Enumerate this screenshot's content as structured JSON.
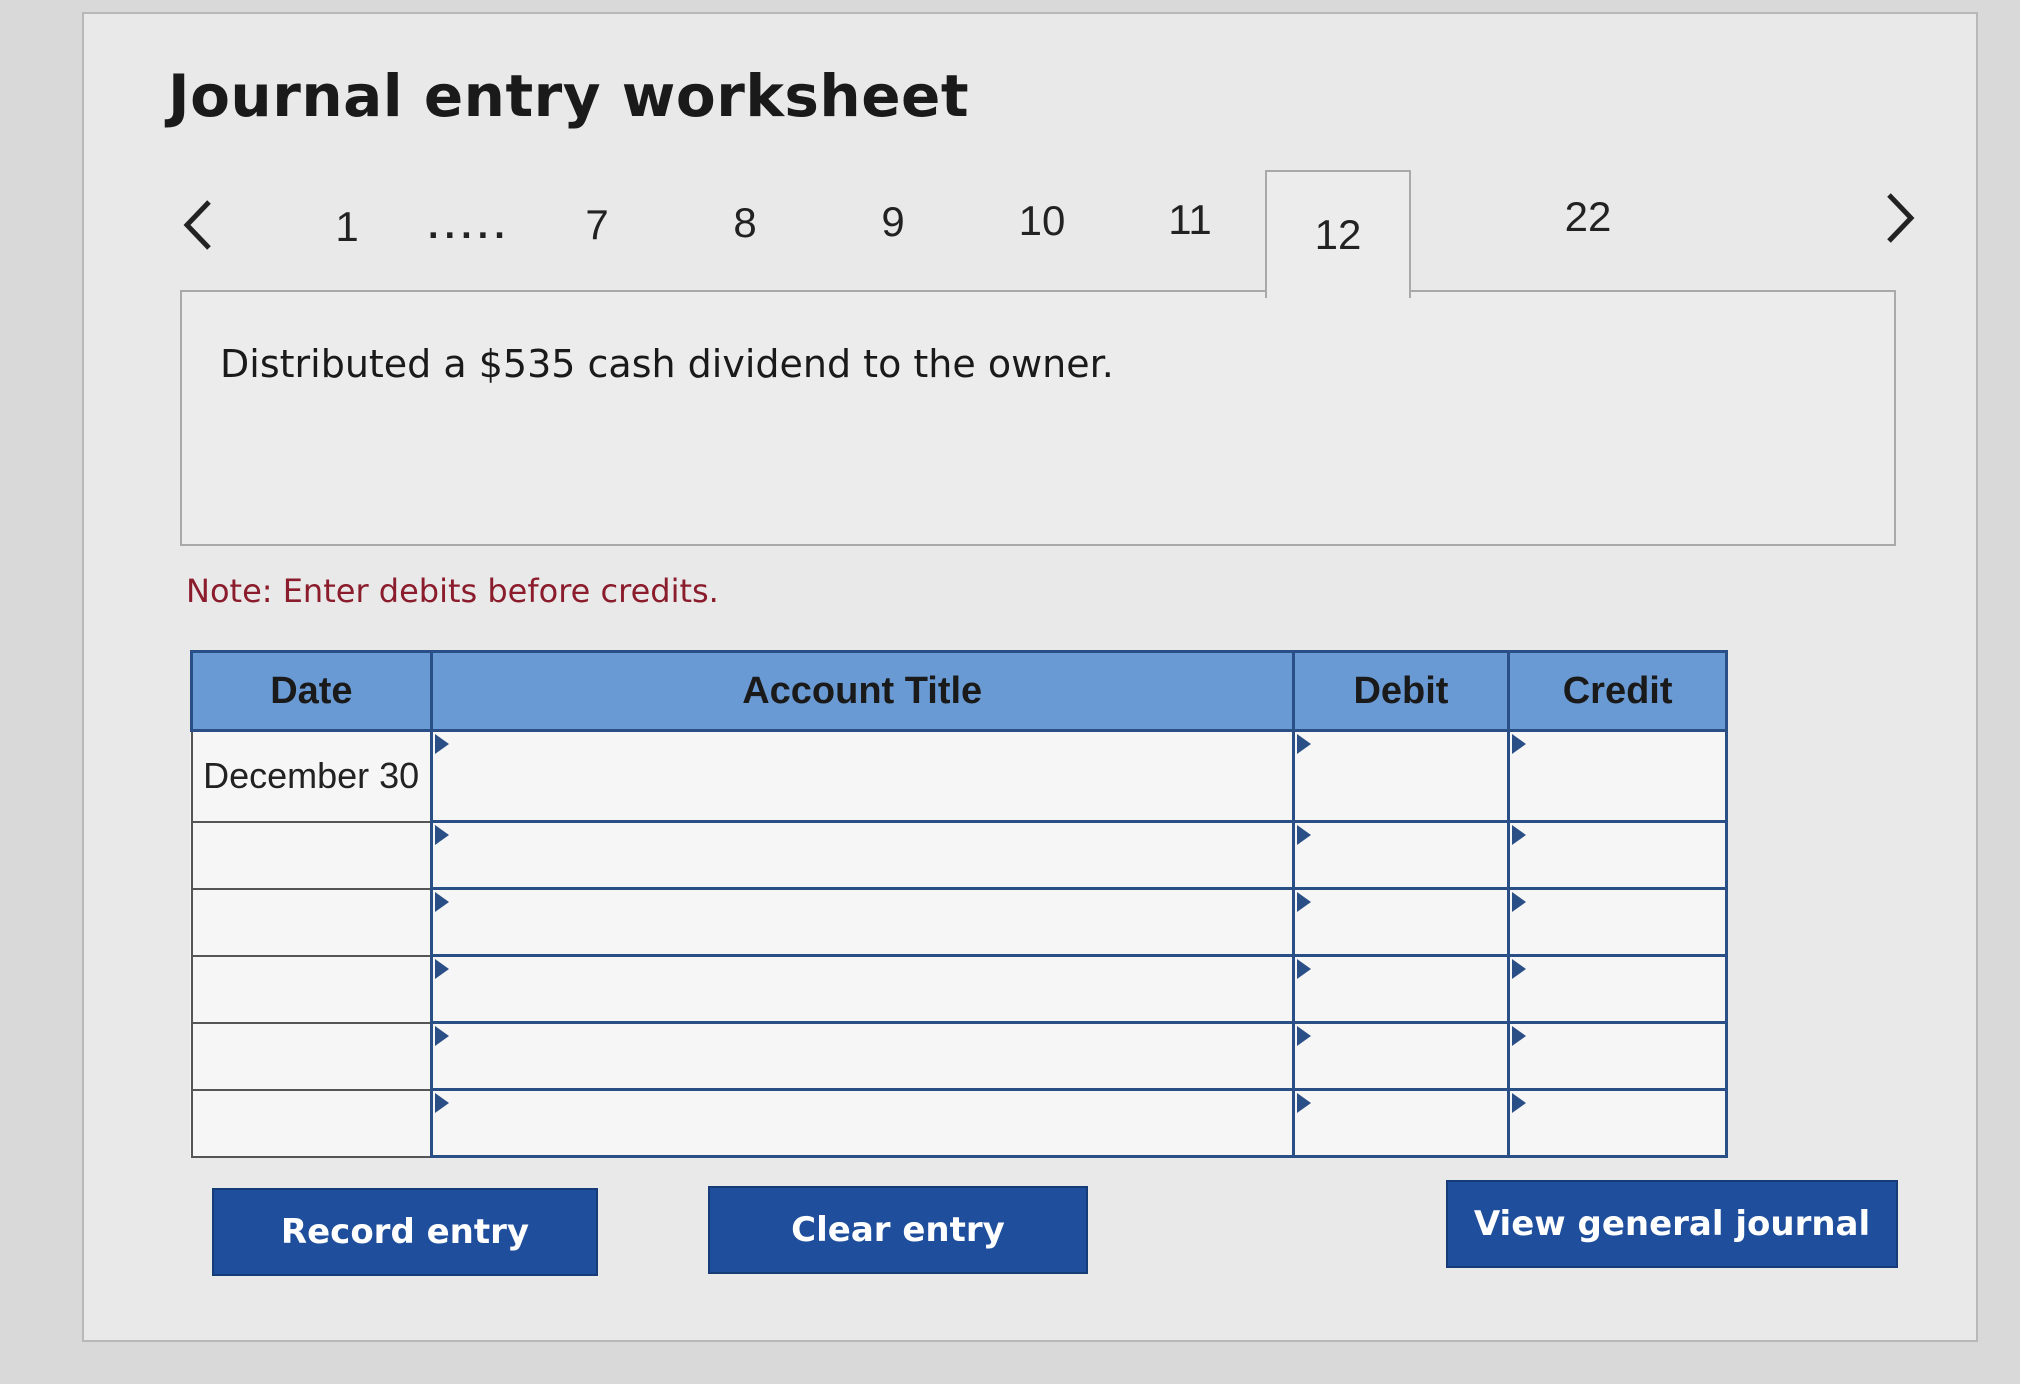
{
  "header": {
    "title": "Journal entry worksheet"
  },
  "nav": {
    "prev_icon": "chevron-left-icon",
    "next_icon": "chevron-right-icon",
    "tabs": [
      {
        "label": "1"
      },
      {
        "label": "7"
      },
      {
        "label": "8"
      },
      {
        "label": "9"
      },
      {
        "label": "10"
      },
      {
        "label": "11"
      },
      {
        "label": "12"
      },
      {
        "label": "22"
      }
    ],
    "ellipsis": ".....",
    "active_tab": "12"
  },
  "transaction": {
    "description": "Distributed a $535 cash dividend to the owner."
  },
  "note": "Note: Enter debits before credits.",
  "journal": {
    "headers": {
      "date": "Date",
      "account": "Account Title",
      "debit": "Debit",
      "credit": "Credit"
    },
    "rows": [
      {
        "date": "December 30",
        "account": "",
        "debit": "",
        "credit": ""
      },
      {
        "date": "",
        "account": "",
        "debit": "",
        "credit": ""
      },
      {
        "date": "",
        "account": "",
        "debit": "",
        "credit": ""
      },
      {
        "date": "",
        "account": "",
        "debit": "",
        "credit": ""
      },
      {
        "date": "",
        "account": "",
        "debit": "",
        "credit": ""
      },
      {
        "date": "",
        "account": "",
        "debit": "",
        "credit": ""
      }
    ]
  },
  "buttons": {
    "record": "Record entry",
    "clear": "Clear entry",
    "view": "View general journal"
  },
  "colors": {
    "header_bg": "#6a9ad4",
    "button_bg": "#1f4f9c",
    "note_text": "#8b1c2c",
    "grid": "#2a4f86"
  }
}
